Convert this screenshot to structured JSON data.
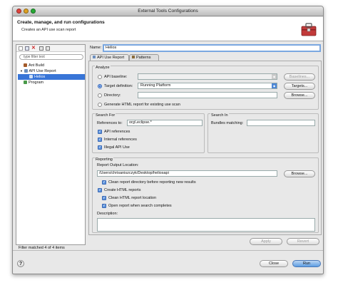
{
  "window": {
    "title": "External Tools Configurations"
  },
  "header": {
    "title": "Create, manage, and run configurations",
    "subtitle": "Creates an API use scan report",
    "icon": "toolbox-icon"
  },
  "left": {
    "toolbar_icons": [
      "new-config-icon",
      "duplicate-icon",
      "delete-icon",
      "collapse-all-icon",
      "filter-icon"
    ],
    "filter_placeholder": "type filter text",
    "tree": [
      {
        "label": "Ant Build",
        "icon": "ant-icon"
      },
      {
        "label": "API Use Report",
        "icon": "report-icon"
      },
      {
        "label": "Helios",
        "icon": "report-icon"
      },
      {
        "label": "Program",
        "icon": "program-icon"
      }
    ],
    "status": "Filter matched 4 of 4 items"
  },
  "config": {
    "name_label": "Name:",
    "name_value": "Helios",
    "tabs": [
      "API Use Report",
      "Patterns"
    ],
    "analyze": {
      "title": "Analyze",
      "api_baseline_label": "API baseline:",
      "baselines_button": "Baselines...",
      "target_label": "Target definition:",
      "target_value": "Running Platform",
      "targets_button": "Targets...",
      "directory_label": "Directory:",
      "browse_button": "Browse...",
      "generate_label": "Generate HTML report for existing use scan"
    },
    "search_for": {
      "title": "Search For",
      "references_label": "References to:",
      "references_value": "org\\.eclipse.*",
      "api_references": "API references",
      "internal_references": "Internal references",
      "illegal_api_use": "Illegal API Use"
    },
    "search_in": {
      "title": "Search In",
      "bundles_label": "Bundles matching:"
    },
    "reporting": {
      "title": "Reporting",
      "location_label": "Report Output Location:",
      "location_value": "/Users/chrisaniszczyk/Desktop/heliosapi",
      "browse_button": "Browse...",
      "clean_dir": "Clean report directory before reporting new results",
      "create_html": "Create HTML reports",
      "clean_html": "Clean HTML report location",
      "open_report": "Open report when search completes",
      "description_label": "Description:"
    },
    "apply_button": "Apply",
    "revert_button": "Revert"
  },
  "footer": {
    "help_icon": "help-icon",
    "close_button": "Close",
    "run_button": "Run"
  },
  "colors": {
    "selection": "#3875d7",
    "primary_button": "#5d9de2"
  }
}
